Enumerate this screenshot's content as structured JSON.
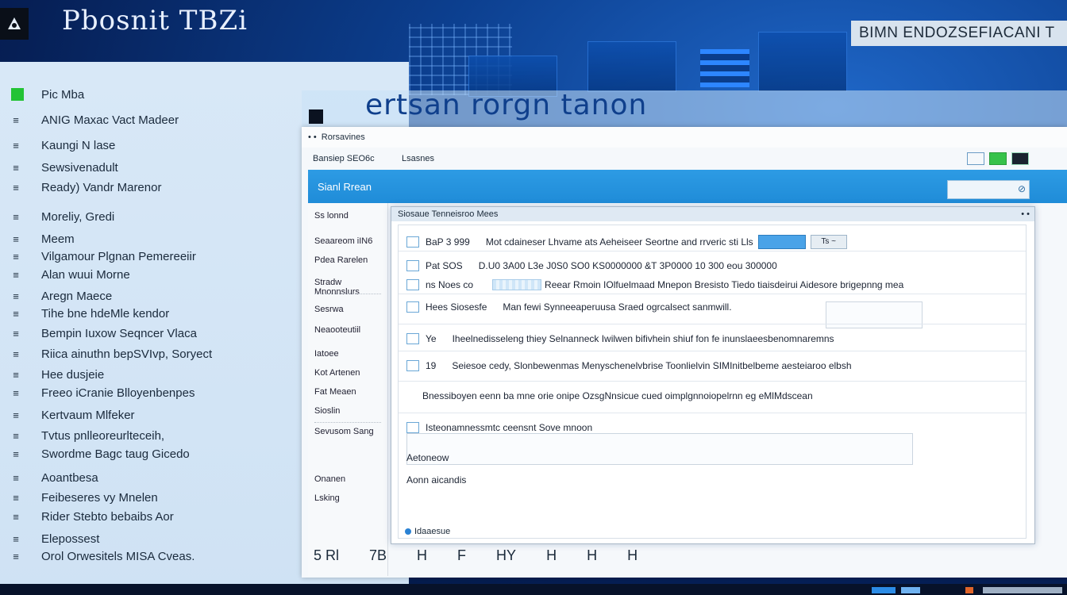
{
  "app_title": "Pbosnit TBZi",
  "top_right_label": "BIMN ENDOZSEFIACANI T",
  "overlay_title": "ertsan rorgn tanon",
  "sidebar": {
    "items": [
      {
        "icon": "green-square-icon",
        "label": "Pic Mba"
      },
      {
        "icon": "number-icon",
        "label": "ANIG Maxac Vact Madeer"
      },
      {
        "icon": "list-icon",
        "label": "Kaungi N lase"
      },
      {
        "icon": "arrow-icon",
        "label": "Sewsivenadult"
      },
      {
        "icon": "doc-icon",
        "label": "Ready) Vandr Marenor"
      },
      {
        "icon": "section-icon",
        "label": "Moreliy, Gredi"
      },
      {
        "icon": "number-icon",
        "label": "Meem"
      },
      {
        "icon": "number-icon",
        "label": "Vilgamour Plgnan Pemereeiir"
      },
      {
        "icon": "number-icon",
        "label": "Alan wuui Morne"
      },
      {
        "icon": "number-icon",
        "label": "Aregn Maece"
      },
      {
        "icon": "number-icon",
        "label": "Tihe bne hdeMle kendor"
      },
      {
        "icon": "number-icon",
        "label": "Bempin Iuxow Seqncer Vlaca"
      },
      {
        "icon": "number-icon",
        "label": "Riica ainuthn bepSVIvp, Soryect"
      },
      {
        "icon": "number-icon",
        "label": "Hee dusjeie"
      },
      {
        "icon": "number-icon",
        "label": "Freeo iCranie Blloyenbenpes"
      },
      {
        "icon": "number-icon",
        "label": "Kertvaum Mlfeker"
      },
      {
        "icon": "number-icon",
        "label": "Tvtus pnlleoreurlteceih,"
      },
      {
        "icon": "number-icon",
        "label": "Swordme Bagc taug Gicedo"
      },
      {
        "icon": "number-icon",
        "label": "Aoantbesa"
      },
      {
        "icon": "number-icon",
        "label": "Feibeseres vy Mnelen"
      },
      {
        "icon": "number-icon",
        "label": "Rider Stebto bebaibs Aor"
      },
      {
        "icon": "number-icon",
        "label": "Elepossest"
      },
      {
        "icon": "number-icon",
        "label": "Orol Orwesitels MISA Cveas."
      }
    ]
  },
  "window": {
    "title": "Rorsavines",
    "toolbar": {
      "left": "Bansiep  SEO6c",
      "right": "Lsasnes"
    },
    "blue_bar_label": "Sianl Rrean",
    "left_pane": [
      "Ss lonnd",
      "Seaareom iIN6",
      "Pdea  Rarelen",
      "Stradw Mnonnslurs",
      "Sesrwa",
      "Neaooteutiil",
      "Iatoee",
      "Kot Artenen",
      "Fat Meaen",
      "Sioslin",
      "Sevusom Sang",
      "Onanen",
      "Lsking"
    ]
  },
  "dialog": {
    "header": "Siosaue Tenneisroo Mees",
    "rows": [
      {
        "col1": "BaP 3  999",
        "col2": "Mot cdaineser  Lhvame  ats  Aeheiseer  Seortne and rrveric sti  Lls",
        "pill": "Ts ~"
      },
      {
        "col1": "Pat  SOS",
        "col2": "D.U0  3A00  L3e  J0S0 SO0  KS0000000  &T 3P0000  10  300  eou  300000"
      },
      {
        "col1": "ns Noes co",
        "col2": "Reear Rmoin  IOlfuelmaad Mnepon Bresisto Tiedo  tiaisdeirui Aidesore brigepnng mea"
      },
      {
        "col1": "Hees Siosesfe",
        "col2": "Man fewi Synneeaperuusa Sraed ogrcalsect sanmwill."
      },
      {
        "col1": "Ye",
        "col2": "Iheelnedisseleng thiey  Selnanneck Iwilwen bifivhein shiuf fon fe inunslaeesbenomnaremns"
      },
      {
        "col1": "19",
        "col2": "Seiesoe cedy, Slonbewenmas  Menyschenelvbrise Toonlielvin  SIMInitbelbeme aesteiaroo elbsh"
      },
      {
        "col1": "",
        "col2": "Bnessiboyen eenn ba mne orie onipe OzsgNnsicue cued oimplgnnoiopelrnn eg eMlMdscean"
      },
      {
        "col1": "Isteonamnessmtc ceensnt Sove mnoon",
        "col2": ""
      },
      {
        "col1": "Aetoneow",
        "col2": ""
      },
      {
        "col1": "Aonn aicandis",
        "col2": ""
      }
    ],
    "footer": "Idaaesue"
  },
  "bottom_icons": [
    "5 Rl",
    "7B",
    "H",
    "F",
    "HY",
    "H",
    "H",
    "H"
  ],
  "colors": {
    "accent_blue": "#1f8cd8",
    "sidebar_bg": "#d8e8f7",
    "desktop_bg": "#0c3f8f",
    "green": "#23c335"
  }
}
